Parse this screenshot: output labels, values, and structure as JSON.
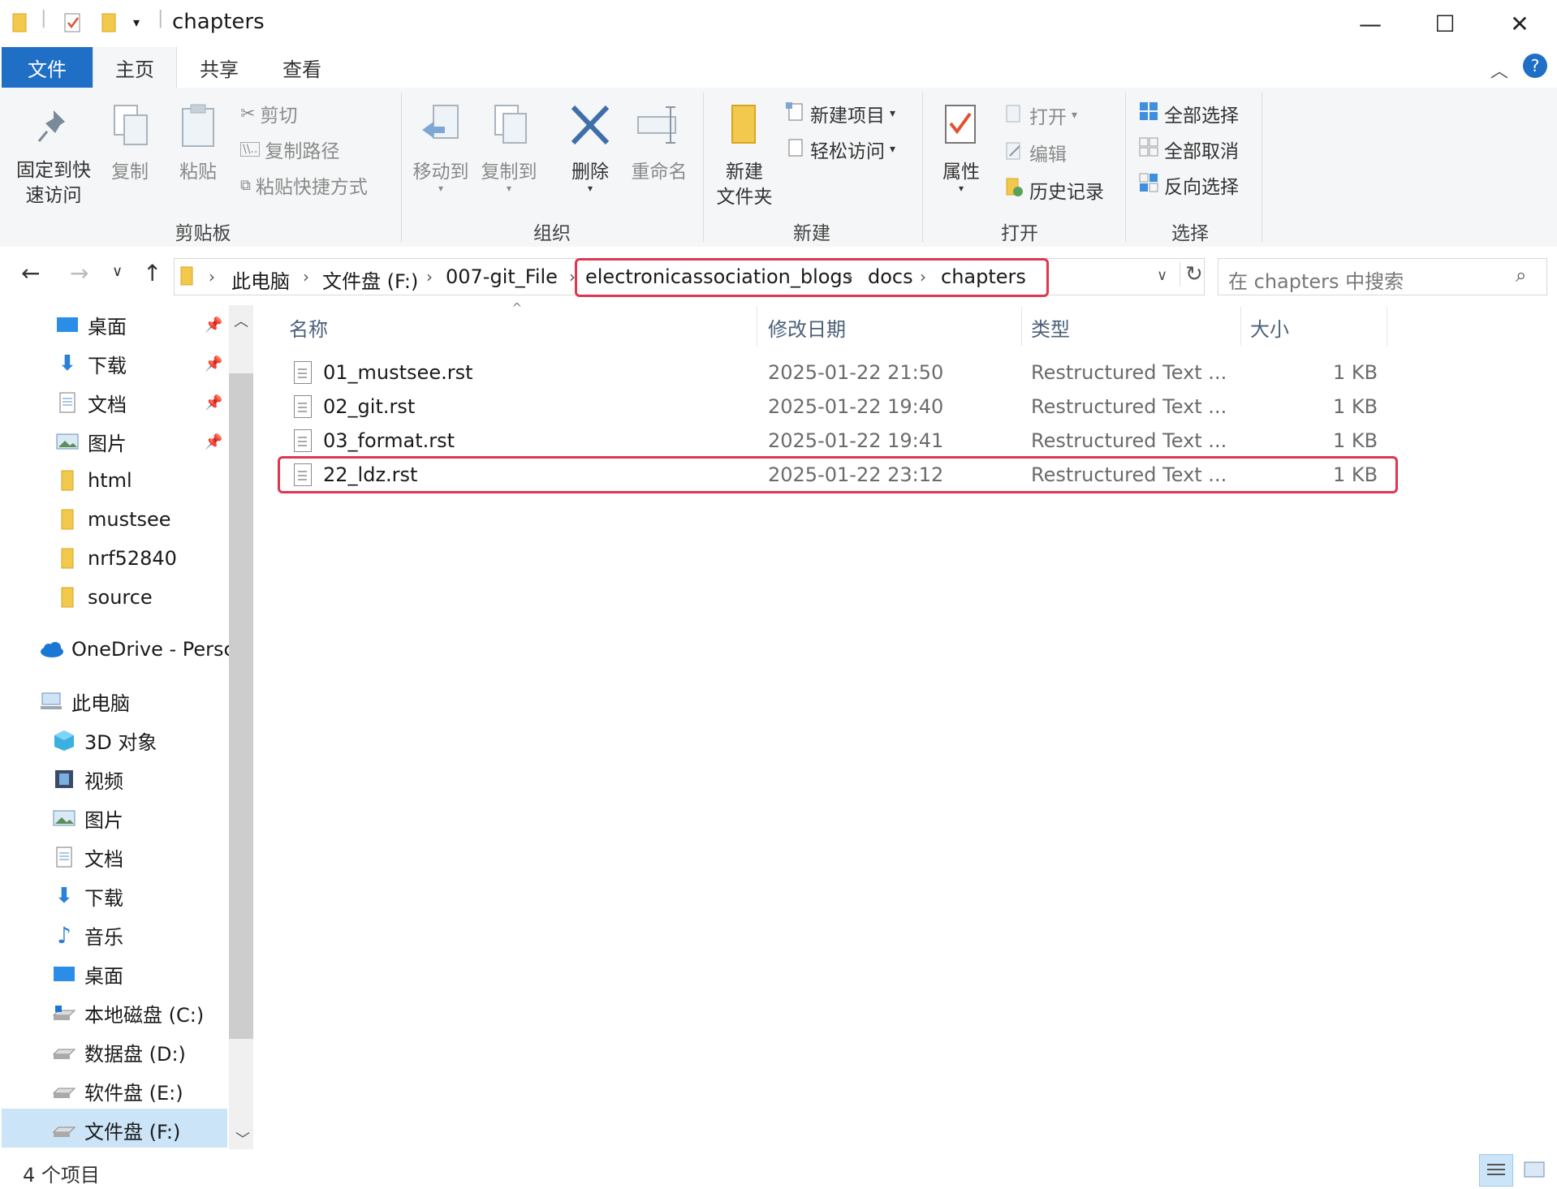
{
  "window": {
    "title": "chapters",
    "minimize": "—",
    "maximize": "☐",
    "close": "✕"
  },
  "tabs": [
    {
      "label": "文件"
    },
    {
      "label": "主页"
    },
    {
      "label": "共享"
    },
    {
      "label": "查看"
    }
  ],
  "ribbon": {
    "clipboard": {
      "pin_label_1": "固定到快",
      "pin_label_2": "速访问",
      "copy": "复制",
      "paste": "粘贴",
      "cut": "剪切",
      "copy_path": "复制路径",
      "paste_shortcut": "粘贴快捷方式",
      "group": "剪贴板"
    },
    "organize": {
      "move_to": "移动到",
      "copy_to": "复制到",
      "delete": "删除",
      "rename": "重命名",
      "group": "组织"
    },
    "new": {
      "new_folder_1": "新建",
      "new_folder_2": "文件夹",
      "new_item": "新建项目",
      "easy_access": "轻松访问",
      "group": "新建"
    },
    "open": {
      "properties": "属性",
      "open": "打开",
      "edit": "编辑",
      "history": "历史记录",
      "group": "打开"
    },
    "select": {
      "select_all": "全部选择",
      "select_none": "全部取消",
      "invert": "反向选择",
      "group": "选择"
    }
  },
  "address": {
    "crumbs": [
      "此电脑",
      "文件盘 (F:)",
      "007-git_File",
      "electronicassociation_blogs",
      "docs",
      "chapters"
    ],
    "search_placeholder": "在 chapters 中搜索"
  },
  "sidebar": {
    "quick_access": [
      {
        "label": "桌面",
        "pinned": true
      },
      {
        "label": "下载",
        "pinned": true
      },
      {
        "label": "文档",
        "pinned": true
      },
      {
        "label": "图片",
        "pinned": true
      },
      {
        "label": "html"
      },
      {
        "label": "mustsee"
      },
      {
        "label": "nrf52840"
      },
      {
        "label": "source"
      }
    ],
    "onedrive": "OneDrive - Persc",
    "this_pc": "此电脑",
    "pc_items": [
      {
        "label": "3D 对象"
      },
      {
        "label": "视频"
      },
      {
        "label": "图片"
      },
      {
        "label": "文档"
      },
      {
        "label": "下载"
      },
      {
        "label": "音乐"
      },
      {
        "label": "桌面"
      },
      {
        "label": "本地磁盘 (C:)"
      },
      {
        "label": "数据盘 (D:)"
      },
      {
        "label": "软件盘 (E:)"
      },
      {
        "label": "文件盘 (F:)"
      }
    ]
  },
  "columns": {
    "name": "名称",
    "date": "修改日期",
    "type": "类型",
    "size": "大小"
  },
  "files": [
    {
      "name": "01_mustsee.rst",
      "date": "2025-01-22 21:50",
      "type": "Restructured Text ...",
      "size": "1 KB"
    },
    {
      "name": "02_git.rst",
      "date": "2025-01-22 19:40",
      "type": "Restructured Text ...",
      "size": "1 KB"
    },
    {
      "name": "03_format.rst",
      "date": "2025-01-22 19:41",
      "type": "Restructured Text ...",
      "size": "1 KB"
    },
    {
      "name": "22_ldz.rst",
      "date": "2025-01-22 23:12",
      "type": "Restructured Text ...",
      "size": "1 KB"
    }
  ],
  "status": {
    "count": "4 个项目"
  },
  "colors": {
    "accent": "#1f6fc6",
    "highlight": "#e0364f",
    "folder": "#f2c94c"
  }
}
